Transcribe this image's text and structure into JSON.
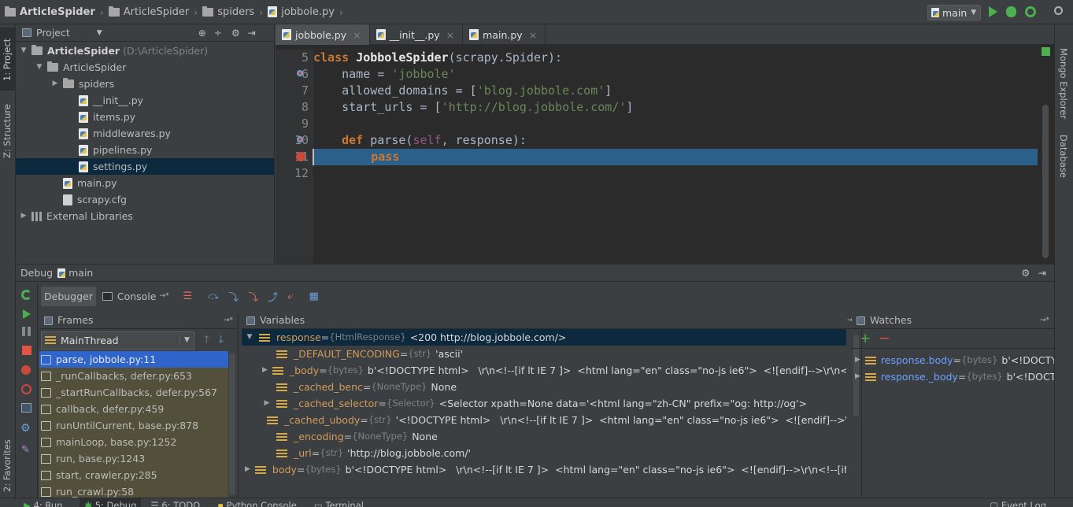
{
  "breadcrumb": {
    "project": "ArticleSpider",
    "folder1": "ArticleSpider",
    "folder2": "spiders",
    "file": "jobbole.py"
  },
  "run_config": "main",
  "left_strip": {
    "project": "1: Project",
    "structure": "Z: Structure",
    "favorites": "2: Favorites"
  },
  "right_strip": {
    "mongo": "Mongo Explorer",
    "database": "Database"
  },
  "project_panel": {
    "title": "Project",
    "tree": [
      {
        "label": "ArticleSpider",
        "hint": "(D:\\ArticleSpider)",
        "type": "folder",
        "depth": 0,
        "arrow": "▼",
        "bold": true
      },
      {
        "label": "ArticleSpider",
        "type": "folder",
        "depth": 1,
        "arrow": "▼"
      },
      {
        "label": "spiders",
        "type": "folder",
        "depth": 2,
        "arrow": "▶"
      },
      {
        "label": "__init__.py",
        "type": "py",
        "depth": 3
      },
      {
        "label": "items.py",
        "type": "py",
        "depth": 3
      },
      {
        "label": "middlewares.py",
        "type": "py",
        "depth": 3
      },
      {
        "label": "pipelines.py",
        "type": "py",
        "depth": 3
      },
      {
        "label": "settings.py",
        "type": "py",
        "depth": 3,
        "selected": true
      },
      {
        "label": "main.py",
        "type": "py",
        "depth": 2
      },
      {
        "label": "scrapy.cfg",
        "type": "cfg",
        "depth": 2
      },
      {
        "label": "External Libraries",
        "type": "lib",
        "depth": 0,
        "arrow": "▶"
      }
    ]
  },
  "editor_tabs": [
    {
      "label": "jobbole.py",
      "active": true
    },
    {
      "label": "__init__.py"
    },
    {
      "label": "main.py"
    }
  ],
  "code_lines": [
    {
      "n": "5",
      "parts": [
        [
          "kw",
          "class "
        ],
        [
          "cls",
          "JobboleSpider"
        ],
        [
          "p",
          "(scrapy.Spider):"
        ]
      ]
    },
    {
      "n": "6",
      "parts": [
        [
          "p",
          "    name = "
        ],
        [
          "str",
          "'jobbole'"
        ]
      ],
      "mark": "override"
    },
    {
      "n": "7",
      "parts": [
        [
          "p",
          "    allowed_domains = ["
        ],
        [
          "str",
          "'blog.jobbole.com'"
        ],
        [
          "p",
          "]"
        ]
      ]
    },
    {
      "n": "8",
      "parts": [
        [
          "p",
          "    start_urls = ["
        ],
        [
          "str",
          "'http://blog.jobbole.com/'"
        ],
        [
          "p",
          "]"
        ]
      ]
    },
    {
      "n": "9",
      "parts": []
    },
    {
      "n": "10",
      "parts": [
        [
          "p",
          "    "
        ],
        [
          "kw",
          "def "
        ],
        [
          "p",
          "parse("
        ],
        [
          "self",
          "self"
        ],
        [
          "p",
          ", response):"
        ]
      ],
      "mark": "override"
    },
    {
      "n": "11",
      "parts": [
        [
          "p",
          "        "
        ],
        [
          "kw",
          "pass"
        ]
      ],
      "mark": "breakpoint",
      "current": true
    },
    {
      "n": "12",
      "parts": []
    }
  ],
  "debug": {
    "title": "Debug",
    "config": "main",
    "tabs": {
      "debugger": "Debugger",
      "console": "Console"
    },
    "frames_title": "Frames",
    "thread": "MainThread",
    "frames": [
      "parse, jobbole.py:11",
      "_runCallbacks, defer.py:653",
      "_startRunCallbacks, defer.py:567",
      "callback, defer.py:459",
      "runUntilCurrent, base.py:878",
      "mainLoop, base.py:1252",
      "run, base.py:1243",
      "start, crawler.py:285",
      "run_crawl.py:58"
    ],
    "variables_title": "Variables",
    "variables": [
      {
        "depth": 0,
        "arrow": "▼",
        "name": "response",
        "type": "{HtmlResponse}",
        "value": "<200 http://blog.jobbole.com/>",
        "selected": true
      },
      {
        "depth": 1,
        "arrow": "",
        "name": "_DEFAULT_ENCODING",
        "type": "{str}",
        "value": "'ascii'"
      },
      {
        "depth": 1,
        "arrow": "▶",
        "name": "_body",
        "type": "{bytes}",
        "value": "b'<!DOCTYPE html>   \\r\\n<!--[if lt IE 7 ]>  <html lang=\"en\" class=\"no-js ie6\">  <![endif]-->\\r\\n<!--[if IE"
      },
      {
        "depth": 1,
        "arrow": "",
        "name": "_cached_benc",
        "type": "{NoneType}",
        "value": "None"
      },
      {
        "depth": 1,
        "arrow": "▶",
        "name": "_cached_selector",
        "type": "{Selector}",
        "value": "<Selector xpath=None data='<html lang=\"zh-CN\" prefix=\"og: http://og'>"
      },
      {
        "depth": 1,
        "arrow": "",
        "name": "_cached_ubody",
        "type": "{str}",
        "value": "'<!DOCTYPE html>   \\r\\n<!--[if lt IE 7 ]>  <html lang=\"en\" class=\"no-js ie6\">  <![endif]-->\\r\\n<!--"
      },
      {
        "depth": 1,
        "arrow": "",
        "name": "_encoding",
        "type": "{NoneType}",
        "value": "None"
      },
      {
        "depth": 1,
        "arrow": "",
        "name": "_url",
        "type": "{str}",
        "value": "'http://blog.jobbole.com/'"
      },
      {
        "depth": 0,
        "arrow": "▶",
        "name": "body",
        "type": "{bytes}",
        "value": "b'<!DOCTYPE html>   \\r\\n<!--[if lt IE 7 ]>  <html lang=\"en\" class=\"no-js ie6\">  <![endif]-->\\r\\n<!--[if IE"
      }
    ],
    "watches_title": "Watches",
    "watches": [
      {
        "name": "response.body",
        "type": "{bytes}",
        "value": "b'<!DOCTYPE"
      },
      {
        "name": "response._body",
        "type": "{bytes}",
        "value": "b'<!DOCT"
      }
    ]
  },
  "bottom_bar": {
    "run": "4: Run",
    "debug": "5: Debug",
    "todo": "6: TODO",
    "pyconsole": "Python Console",
    "terminal": "Terminal",
    "eventlog": "Event Log"
  }
}
